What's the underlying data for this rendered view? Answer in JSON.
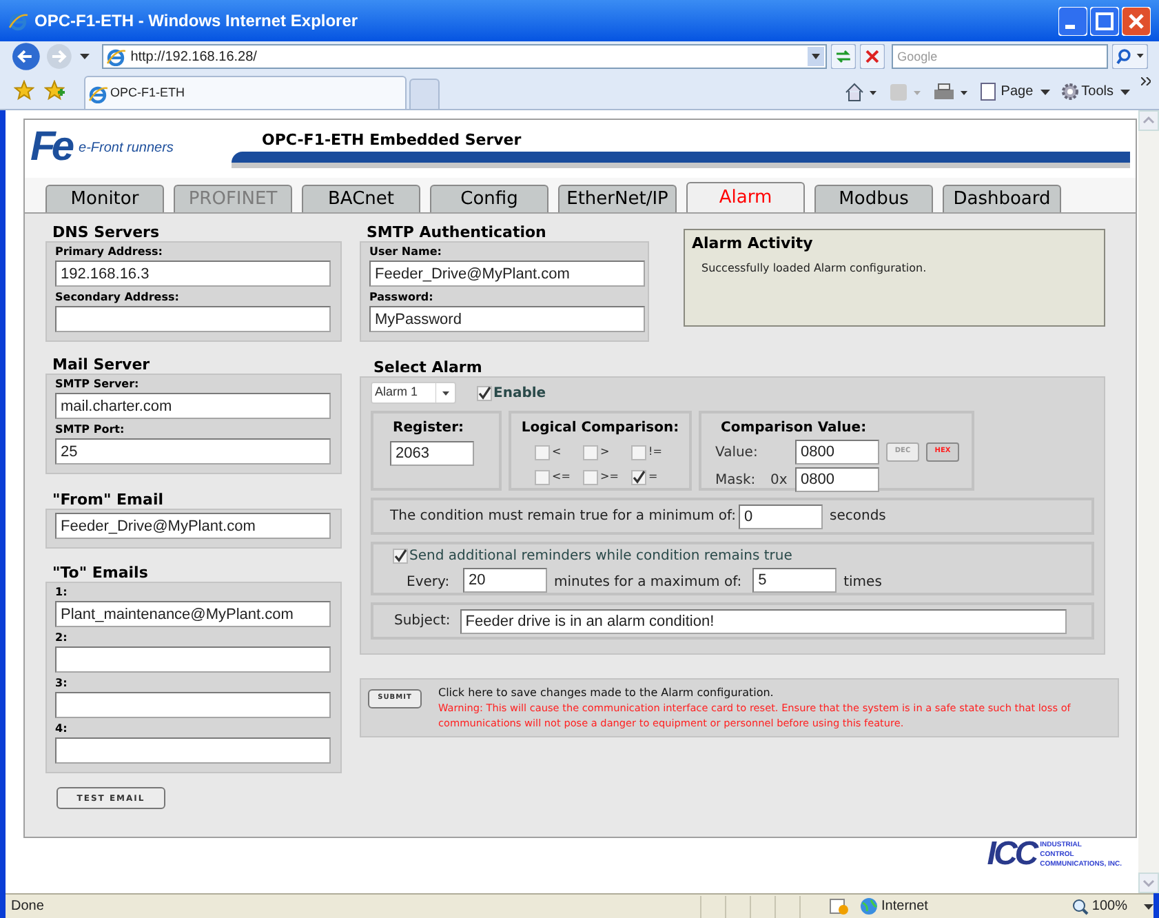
{
  "browser": {
    "title": "OPC-F1-ETH - Windows Internet Explorer",
    "address": "http://192.168.16.28/",
    "search_placeholder": "Google",
    "tab": "OPC-F1-ETH",
    "toolbar": [
      "Page",
      "Tools"
    ]
  },
  "header": {
    "logo_mark": "Fe",
    "logo_text": "e-Front runners",
    "title": "OPC-F1-ETH Embedded Server"
  },
  "tabs": [
    {
      "label": "Monitor",
      "selected": false,
      "disabled": false
    },
    {
      "label": "PROFINET",
      "selected": false,
      "disabled": true
    },
    {
      "label": "BACnet",
      "selected": false,
      "disabled": false
    },
    {
      "label": "Config",
      "selected": false,
      "disabled": false
    },
    {
      "label": "EtherNet/IP",
      "selected": false,
      "disabled": false
    },
    {
      "label": "Alarm",
      "selected": true,
      "disabled": false
    },
    {
      "label": "Modbus",
      "selected": false,
      "disabled": false
    },
    {
      "label": "Dashboard",
      "selected": false,
      "disabled": false
    }
  ],
  "left_groups": [
    {
      "heading": "DNS Servers",
      "fields": [
        {
          "label": "Primary Address:",
          "value": "192.168.16.3"
        },
        {
          "label": "Secondary Address:"
        }
      ]
    },
    {
      "heading": "Mail Server",
      "fields": [
        {
          "label": "SMTP Server:",
          "value": "mail.charter.com"
        },
        {
          "label": "SMTP Port:",
          "value": "25"
        }
      ]
    },
    {
      "heading": "\"From\" Email",
      "fields": [
        {
          "value": "Feeder_Drive@MyPlant.com"
        }
      ]
    },
    {
      "heading": "\"To\" Emails",
      "fields": [
        {
          "label": "1:",
          "value": "Plant_maintenance@MyPlant.com"
        },
        {
          "label": "2:"
        },
        {
          "label": "3:"
        },
        {
          "label": "4:"
        }
      ]
    }
  ],
  "test_button": "TEST EMAIL",
  "smtp_auth": {
    "heading": "SMTP Authentication",
    "fields": [
      {
        "label": "User Name:",
        "value": "Feeder_Drive@MyPlant.com"
      },
      {
        "label": "Password:",
        "value": "MyPassword"
      }
    ]
  },
  "alarm_activity": {
    "title": "Alarm Activity",
    "message": "Successfully loaded Alarm configuration."
  },
  "select_alarm": {
    "heading": "Select Alarm",
    "alarm": "Alarm 1",
    "enable": {
      "label": "Enable",
      "checked": true
    },
    "register": {
      "label": "Register:",
      "value": "2063"
    },
    "logical_comparison": {
      "label": "Logical Comparison:",
      "options": [
        {
          "label": "<",
          "checked": false
        },
        {
          "label": ">",
          "checked": false
        },
        {
          "label": "!=",
          "checked": false
        },
        {
          "label": "<=",
          "checked": false
        },
        {
          "label": ">=",
          "checked": false
        },
        {
          "label": "=",
          "checked": true
        }
      ]
    },
    "comparison_value": {
      "label": "Comparison Value:",
      "value_label": "Value:",
      "value": "0800",
      "mask_label": "Mask:",
      "mask_prefix": "0x",
      "mask": "0800",
      "formats": [
        {
          "label": "DEC",
          "selected": false
        },
        {
          "label": "HEX",
          "selected": true
        }
      ]
    },
    "minimum": {
      "text": "The condition must remain true for a minimum of:",
      "value": "0",
      "unit": "seconds"
    },
    "reminders": {
      "label": "Send additional reminders while condition remains true",
      "checked": true,
      "every_label": "Every:",
      "every": "20",
      "middle": "minutes for a maximum of:",
      "maximum": "5",
      "unit": "times"
    },
    "subject": {
      "label": "Subject:",
      "value": "Feeder drive is in an alarm condition!"
    }
  },
  "submit": {
    "button": "SUBMIT",
    "note": "Click here to save changes made to the Alarm configuration.",
    "warning": "Warning: This will cause the communication interface card to reset. Ensure that the system is in a safe state such that loss of communications will not pose a danger to equipment or personnel before using this feature."
  },
  "footer_logo": {
    "mark": "ICC",
    "lines": [
      "INDUSTRIAL",
      "CONTROL",
      "COMMUNICATIONS, INC."
    ]
  },
  "status_bar": {
    "text": "Done",
    "zone": "Internet",
    "zoom": "100%"
  }
}
